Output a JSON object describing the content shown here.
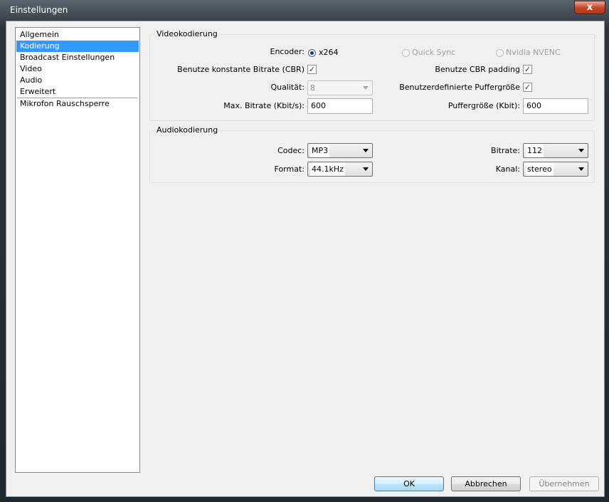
{
  "window": {
    "title": "Einstellungen",
    "close_label": "x"
  },
  "nav": {
    "items": [
      {
        "label": "Allgemein"
      },
      {
        "label": "Kodierung"
      },
      {
        "label": "Broadcast Einstellungen"
      },
      {
        "label": "Video"
      },
      {
        "label": "Audio"
      },
      {
        "label": "Erweitert"
      },
      {
        "label": "Mikrofon Rauschsperre"
      }
    ],
    "selected": "Kodierung"
  },
  "video": {
    "title": "Videokodierung",
    "encoder_label": "Encoder:",
    "encoder_options": [
      {
        "label": "x264",
        "selected": true,
        "enabled": true
      },
      {
        "label": "Quick Sync",
        "selected": false,
        "enabled": false
      },
      {
        "label": "Nvidia NVENC",
        "selected": false,
        "enabled": false
      }
    ],
    "cbr_label": "Benutze konstante Bitrate (CBR)",
    "cbr_checked": true,
    "cbr_padding_label": "Benutze CBR padding",
    "cbr_padding_checked": true,
    "quality_label": "Qualität:",
    "quality_value": "8",
    "custom_buffer_label": "Benutzerdefinierte Puffergröße",
    "custom_buffer_checked": true,
    "max_bitrate_label": "Max. Bitrate (Kbit/s):",
    "max_bitrate_value": "600",
    "buffer_size_label": "Puffergröße (Kbit):",
    "buffer_size_value": "600"
  },
  "audio": {
    "title": "Audiokodierung",
    "codec_label": "Codec:",
    "codec_value": "MP3",
    "bitrate_label": "Bitrate:",
    "bitrate_value": "112",
    "format_label": "Format:",
    "format_value": "44.1kHz",
    "channel_label": "Kanal:",
    "channel_value": "stereo"
  },
  "buttons": {
    "ok": "OK",
    "cancel": "Abbrechen",
    "apply": "Übernehmen"
  }
}
